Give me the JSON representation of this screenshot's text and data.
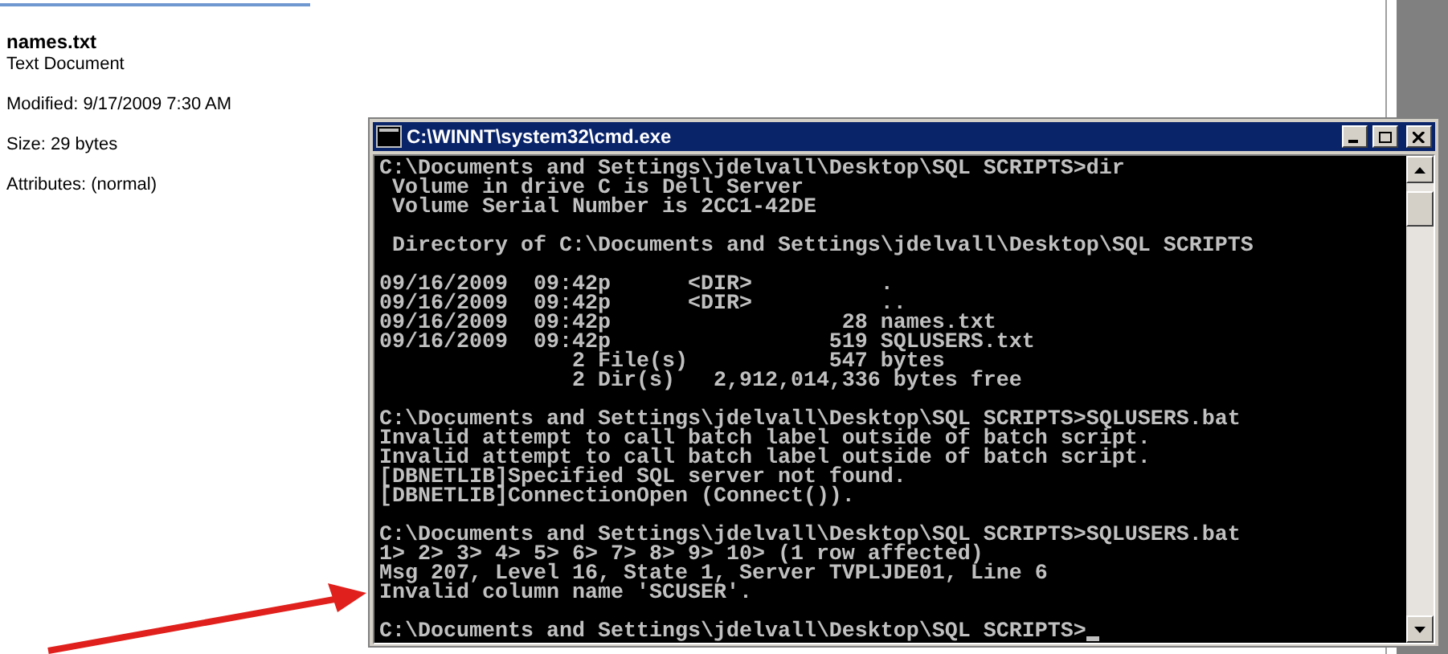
{
  "details_pane": {
    "file_name": "names.txt",
    "file_type": "Text Document",
    "properties": [
      "Modified: 9/17/2009 7:30 AM",
      "Size: 29 bytes",
      "Attributes: (normal)"
    ]
  },
  "console_window": {
    "title": "C:\\WINNT\\system32\\cmd.exe",
    "blocks": [
      [
        "C:\\Documents and Settings\\jdelvall\\Desktop\\SQL SCRIPTS>dir",
        " Volume in drive C is Dell Server",
        " Volume Serial Number is 2CC1-42DE"
      ],
      [
        " Directory of C:\\Documents and Settings\\jdelvall\\Desktop\\SQL SCRIPTS"
      ],
      [
        "09/16/2009  09:42p      <DIR>          .",
        "09/16/2009  09:42p      <DIR>          ..",
        "09/16/2009  09:42p                  28 names.txt",
        "09/16/2009  09:42p                 519 SQLUSERS.txt",
        "               2 File(s)           547 bytes",
        "               2 Dir(s)   2,912,014,336 bytes free"
      ],
      [
        "C:\\Documents and Settings\\jdelvall\\Desktop\\SQL SCRIPTS>SQLUSERS.bat",
        "Invalid attempt to call batch label outside of batch script.",
        "Invalid attempt to call batch label outside of batch script.",
        "[DBNETLIB]Specified SQL server not found.",
        "[DBNETLIB]ConnectionOpen (Connect())."
      ],
      [
        "C:\\Documents and Settings\\jdelvall\\Desktop\\SQL SCRIPTS>SQLUSERS.bat",
        "1> 2> 3> 4> 5> 6> 7> 8> 9> 10> (1 row affected)",
        "Msg 207, Level 16, State 1, Server TVPLJDE01, Line 6",
        "Invalid column name 'SCUSER'."
      ]
    ],
    "prompt": "C:\\Documents and Settings\\jdelvall\\Desktop\\SQL SCRIPTS>"
  }
}
